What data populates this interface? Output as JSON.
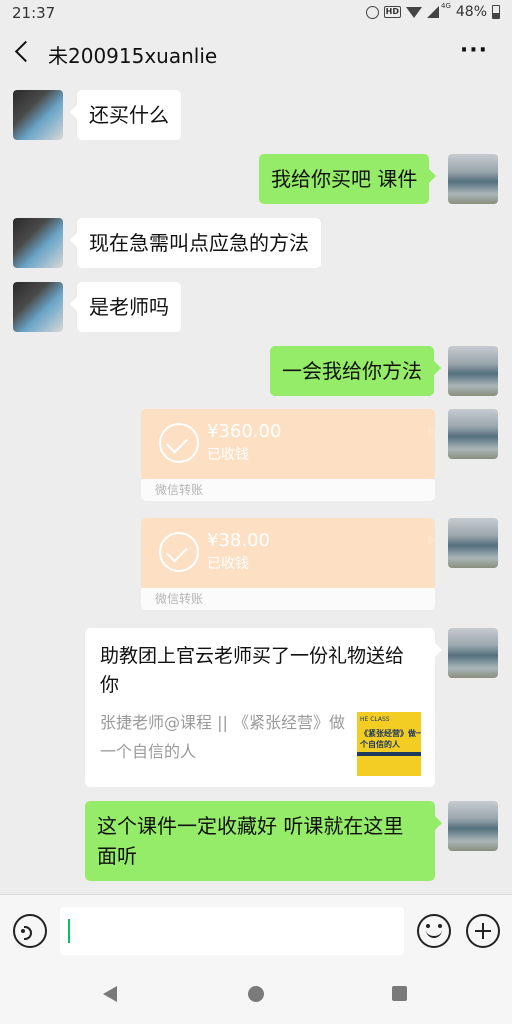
{
  "status_bar": {
    "time": "21:37",
    "network": "4G",
    "battery": "48%"
  },
  "header": {
    "title": "未200915xuanlie"
  },
  "messages": [
    {
      "side": "in",
      "type": "text",
      "text": "还买什么"
    },
    {
      "side": "out",
      "type": "text",
      "text": "我给你买吧 课件"
    },
    {
      "side": "in",
      "type": "text",
      "text": "现在急需叫点应急的方法"
    },
    {
      "side": "in",
      "type": "text",
      "text": "是老师吗"
    },
    {
      "side": "out",
      "type": "text",
      "text": "一会我给你方法"
    },
    {
      "side": "out",
      "type": "transfer",
      "amount": "¥360.00",
      "status": "已收钱",
      "label": "微信转账"
    },
    {
      "side": "out",
      "type": "transfer",
      "amount": "¥38.00",
      "status": "已收钱",
      "label": "微信转账"
    },
    {
      "side": "out",
      "type": "gift",
      "title": "助教团上官云老师买了一份礼物送给你",
      "description": "张捷老师@课程 || 《紧张经营》做一个自信的人",
      "thumb_caption": "HE CLASS",
      "thumb_title": "《紧张经营》做一个自信的人"
    },
    {
      "side": "out",
      "type": "text",
      "text": "这个课件一定收藏好 听课就在这里面听"
    }
  ],
  "input": {
    "value": ""
  },
  "colors": {
    "background": "#ededed",
    "outgoing_bubble": "#95ec69",
    "incoming_bubble": "#ffffff",
    "transfer": "#fde0c4",
    "accent": "#07c160"
  },
  "icons": {
    "back": "chevron-left-icon",
    "more": "more-icon",
    "voice": "voice-icon",
    "emoji": "emoji-icon",
    "plus": "plus-icon"
  }
}
